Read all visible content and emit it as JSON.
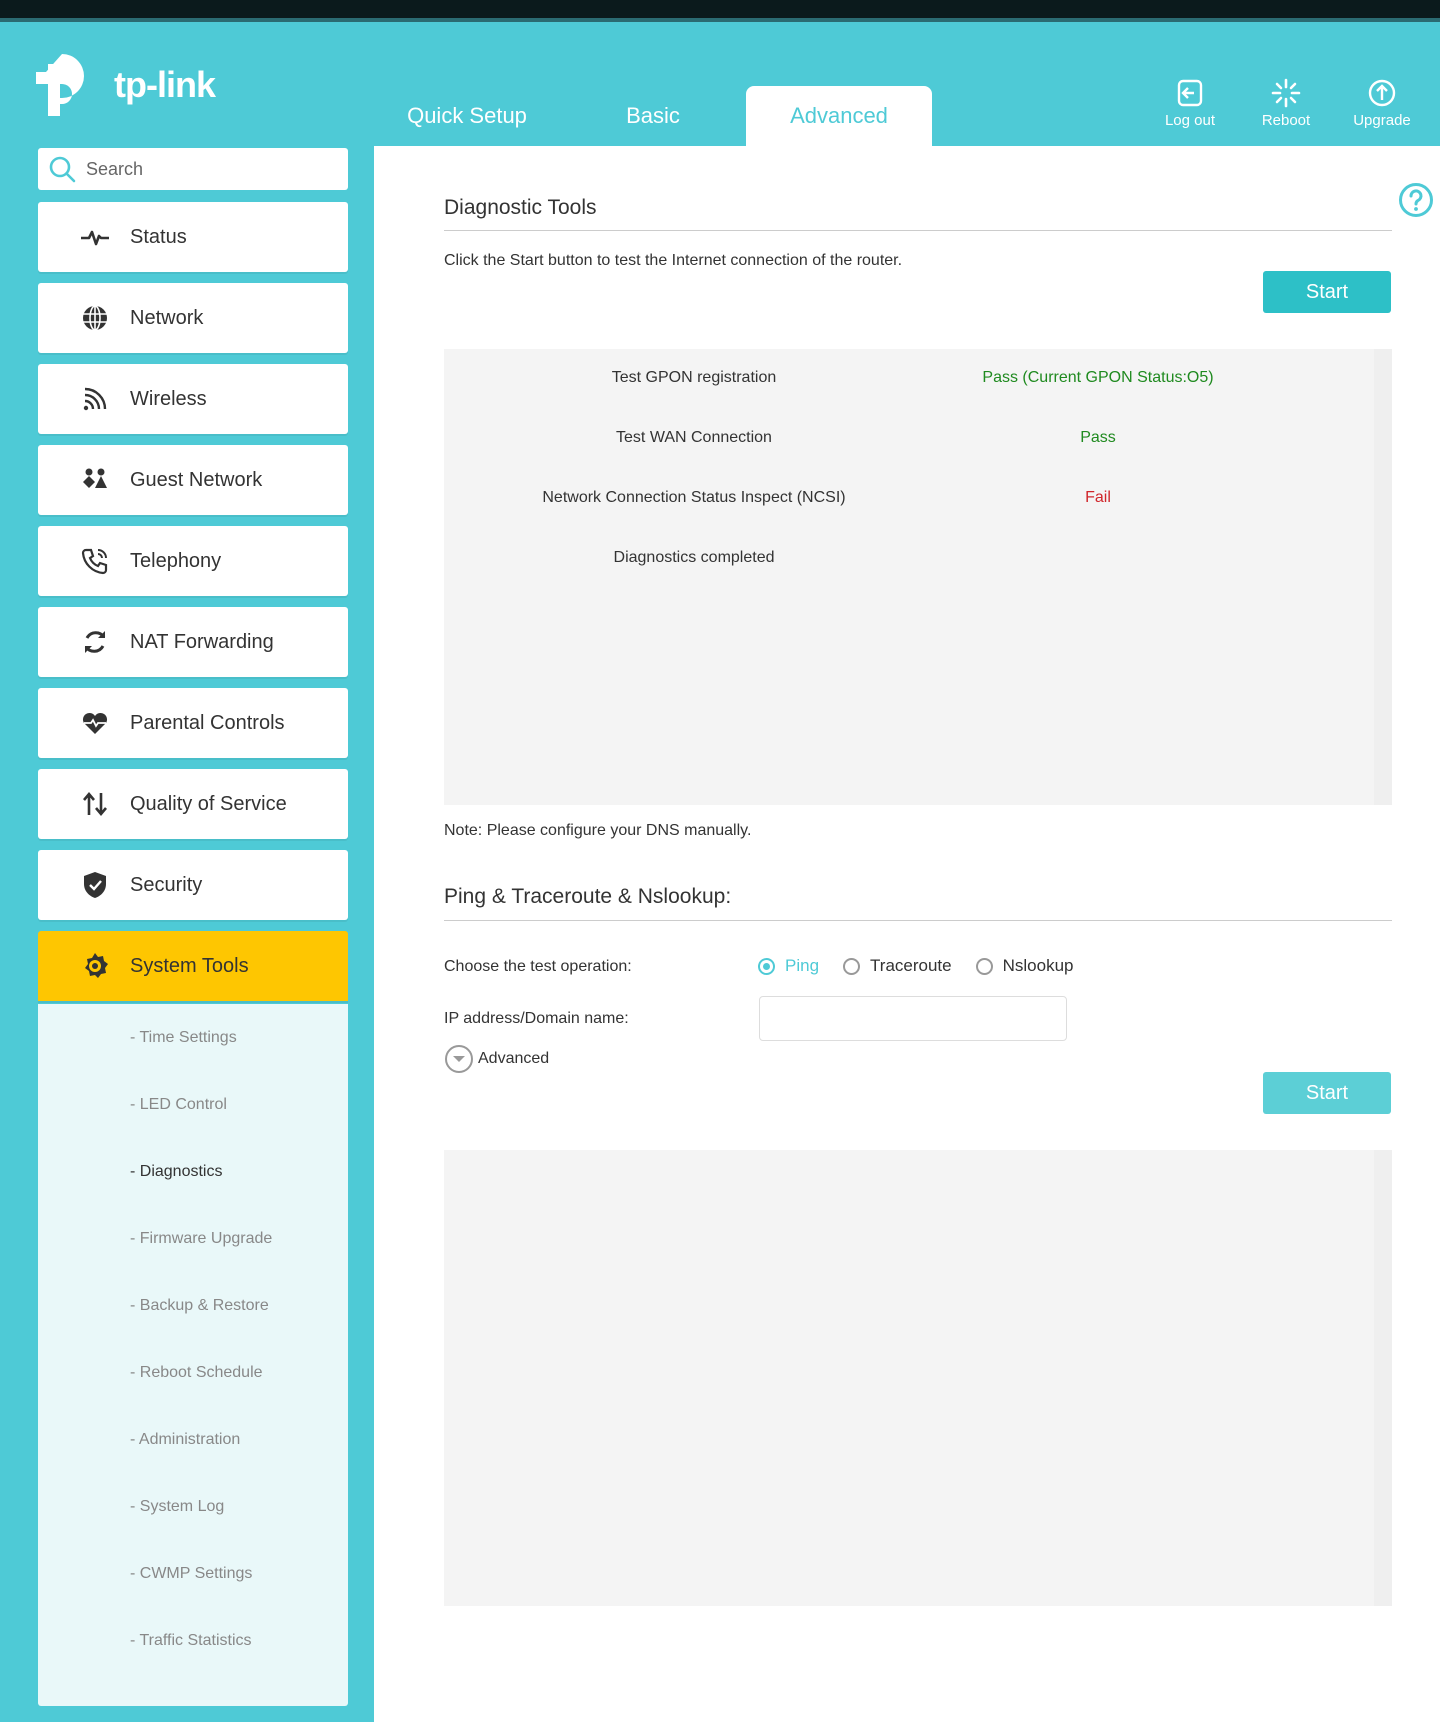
{
  "brand": {
    "name": "tp-link"
  },
  "tabs": [
    {
      "label": "Quick Setup"
    },
    {
      "label": "Basic"
    },
    {
      "label": "Advanced"
    }
  ],
  "top_actions": {
    "logout": "Log out",
    "reboot": "Reboot",
    "upgrade": "Upgrade"
  },
  "search": {
    "placeholder": "Search"
  },
  "menu": {
    "items": [
      {
        "label": "Status",
        "icon": "pulse-icon"
      },
      {
        "label": "Network",
        "icon": "globe-icon"
      },
      {
        "label": "Wireless",
        "icon": "wifi-icon"
      },
      {
        "label": "Guest Network",
        "icon": "guests-icon"
      },
      {
        "label": "Telephony",
        "icon": "phone-icon"
      },
      {
        "label": "NAT Forwarding",
        "icon": "refresh-icon"
      },
      {
        "label": "Parental Controls",
        "icon": "heart-icon"
      },
      {
        "label": "Quality of Service",
        "icon": "updown-arrows-icon"
      },
      {
        "label": "Security",
        "icon": "shield-icon"
      },
      {
        "label": "System Tools",
        "icon": "gear-icon"
      }
    ],
    "submenu": [
      "- Time Settings",
      "- LED Control",
      "- Diagnostics",
      "- Firmware Upgrade",
      "- Backup & Restore",
      "- Reboot Schedule",
      "- Administration",
      "- System Log",
      "- CWMP Settings",
      "- Traffic Statistics"
    ]
  },
  "diagnostic": {
    "title": "Diagnostic Tools",
    "description": "Click the Start button to test the Internet connection of the router.",
    "start_label": "Start",
    "rows": [
      {
        "label": "Test GPON registration",
        "value": "Pass (Current GPON Status:O5)"
      },
      {
        "label": "Test WAN Connection",
        "value": "Pass"
      },
      {
        "label": "Network Connection Status Inspect (NCSI)",
        "value": "Fail"
      },
      {
        "label": "Diagnostics completed",
        "value": ""
      }
    ],
    "note": "Note: Please configure your DNS manually."
  },
  "ping": {
    "title": "Ping & Traceroute & Nslookup:",
    "operation_label": "Choose the test operation:",
    "options": [
      "Ping",
      "Traceroute",
      "Nslookup"
    ],
    "ip_label": "IP address/Domain name:",
    "ip_value": "",
    "advanced_label": "Advanced",
    "start_label": "Start"
  },
  "colors": {
    "brand": "#4ecad6",
    "active_menu": "#fec601",
    "button": "#2dc0c7",
    "pass": "#1f8a1f",
    "fail": "#d0262b"
  }
}
